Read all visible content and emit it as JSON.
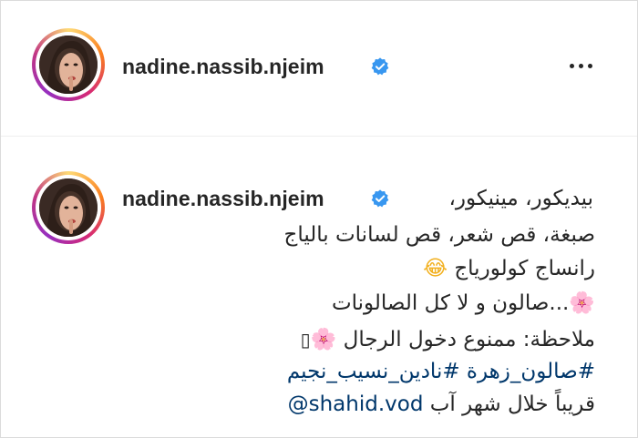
{
  "header": {
    "username": "nadine.nassib.njeim",
    "verified_icon": "verified-badge-icon",
    "more_icon": "more-options-icon"
  },
  "caption": {
    "username": "nadine.nassib.njeim",
    "line1": "بيديكور، مينيكور،",
    "line2": "صبغة، قص شعر، قص لسانات بالياج",
    "line3_text": "رانساج كولورياج",
    "line3_emoji": "😂",
    "line4_text": "...صالون و لا كل الصالونات",
    "line4_emoji": "🌸",
    "line5_text": "ملاحظة: ممنوع دخول الرجال",
    "line5_emoji": "🌸",
    "line5_box": "▯",
    "line6": "#صالون_زهرة #نادين_نسيب_نجيم",
    "line7_text": "قريباً خلال شهر آب",
    "line7_mention": "@shahid.vod"
  },
  "colors": {
    "text": "#262626",
    "link": "#00376b",
    "verified": "#3897f0",
    "border": "#dbdbdb"
  }
}
